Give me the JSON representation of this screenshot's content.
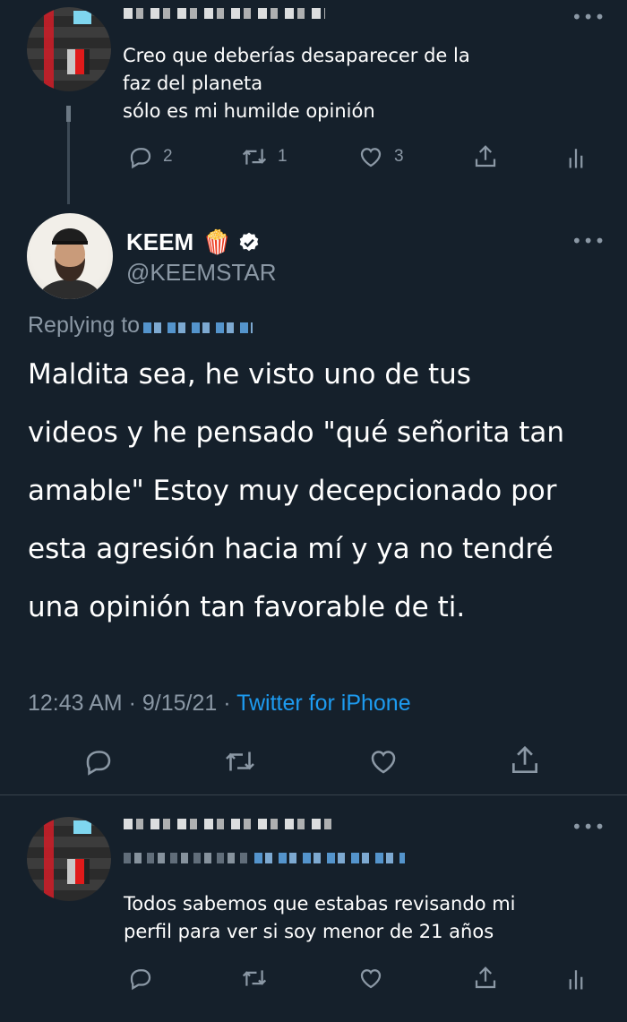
{
  "tweet_top": {
    "text_lines": [
      "Creo que deberías desaparecer de la",
      "faz del planeta",
      "sólo es mi humilde opinión"
    ],
    "replies": "2",
    "retweets": "1",
    "likes": "3"
  },
  "main_tweet": {
    "name": "KEEM",
    "name_emoji": "🍿",
    "handle": "@KEEMSTAR",
    "replying_to_label": "Replying to",
    "text_lines": [
      "Maldita sea, he visto uno de tus",
      "videos y he pensado \"qué señorita tan",
      "amable\" Estoy muy decepcionado por",
      "esta agresión hacia mí y ya no tendré",
      "una opinión tan favorable de ti."
    ],
    "time": "12:43 AM",
    "date": "9/15/21",
    "separator": "·",
    "source": "Twitter for iPhone"
  },
  "tweet_bottom": {
    "text_lines": [
      "Todos sabemos que estabas revisando mi",
      "perfil para ver si soy menor de 21 años"
    ]
  },
  "icons": {
    "reply": "reply-icon",
    "retweet": "retweet-icon",
    "like": "heart-icon",
    "share": "share-icon",
    "analytics": "analytics-icon",
    "more": "more-icon",
    "verified": "verified-badge-icon"
  },
  "colors": {
    "background": "#15202b",
    "muted": "#8b98a5",
    "link": "#1d9bf0"
  }
}
